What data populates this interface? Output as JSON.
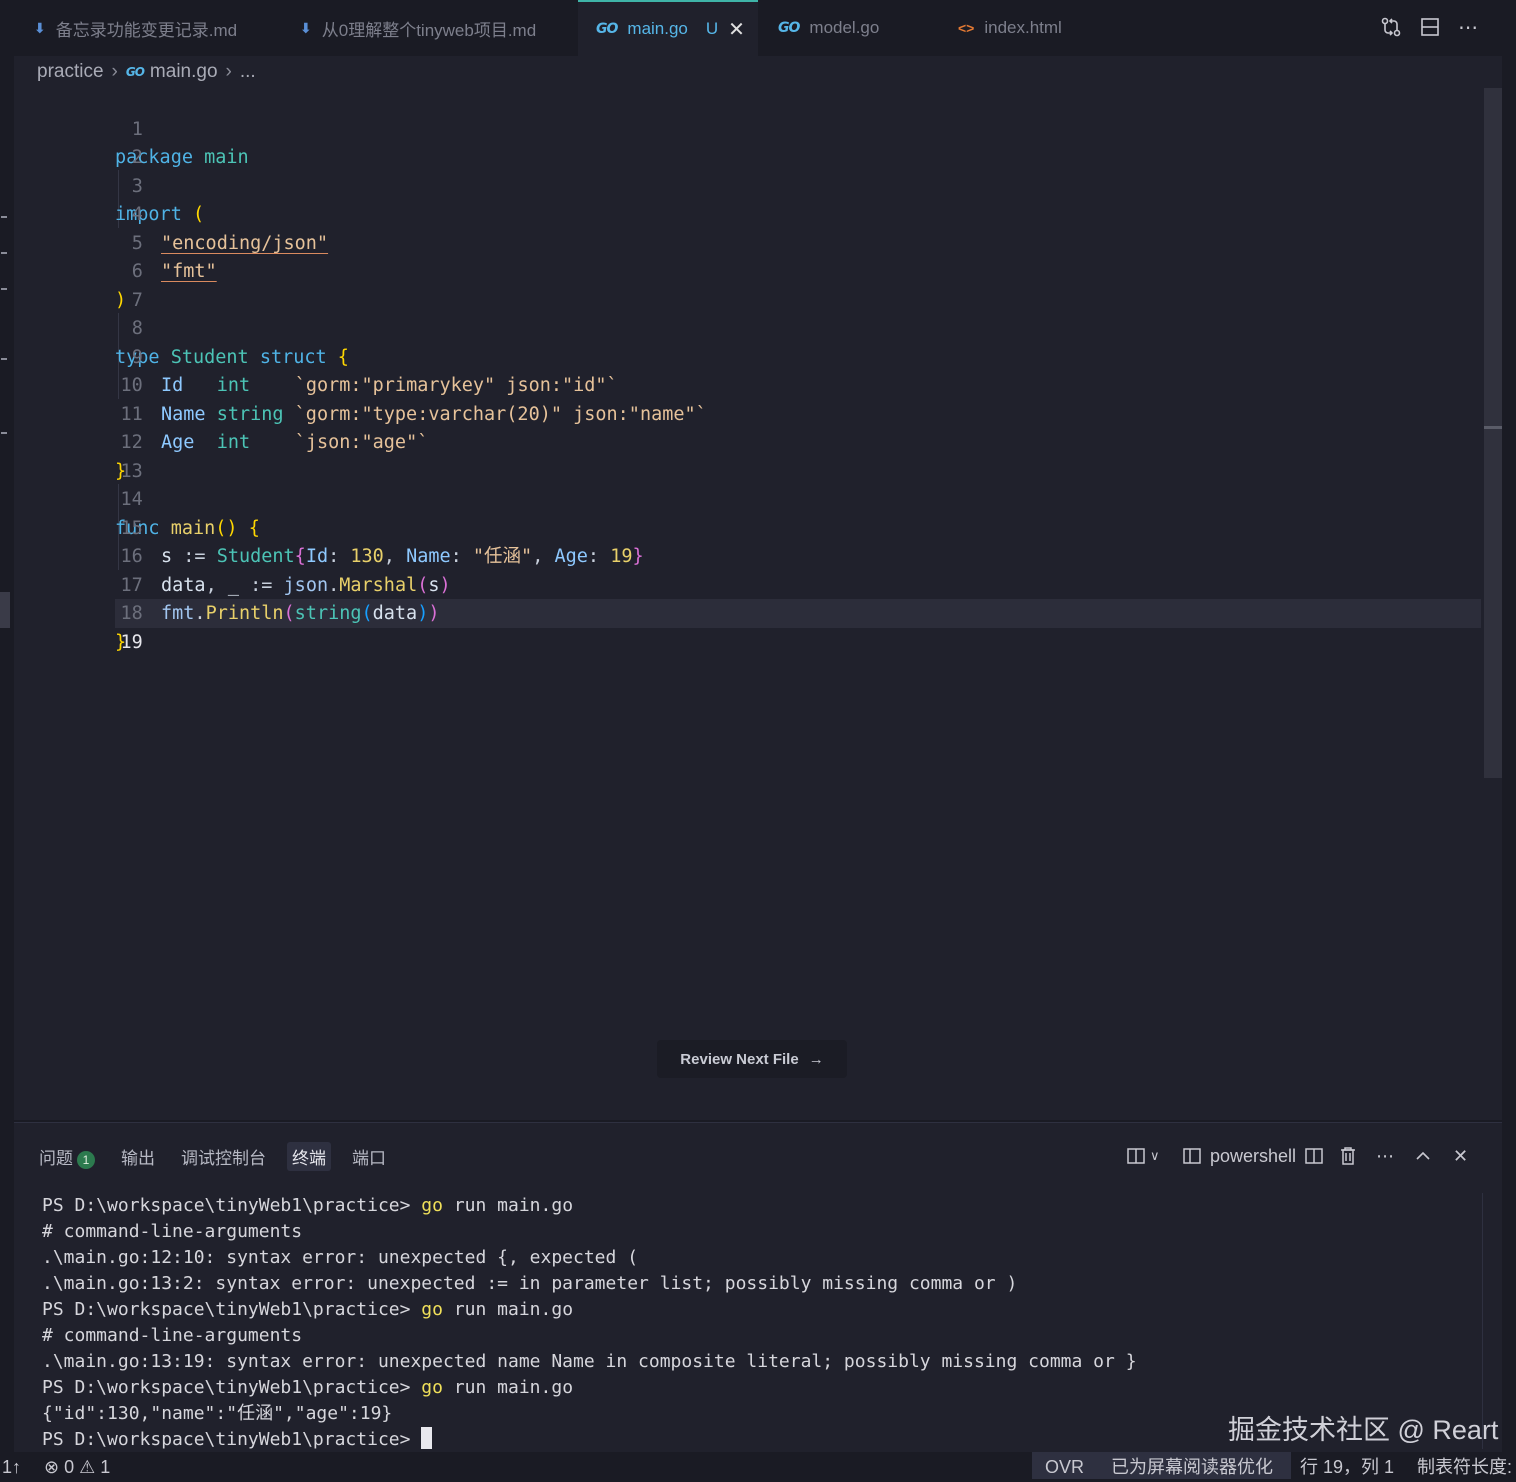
{
  "tabs": [
    {
      "label": "备忘录功能变更记录.md",
      "icon": "markdown-icon",
      "active": false
    },
    {
      "label": "从0理解整个tinyweb项目.md",
      "icon": "markdown-icon",
      "active": false
    },
    {
      "label": "main.go",
      "icon": "go-icon",
      "active": true,
      "modified": "U"
    },
    {
      "label": "model.go",
      "icon": "go-icon",
      "active": false
    },
    {
      "label": "index.html",
      "icon": "html-icon",
      "active": false
    }
  ],
  "icons": {
    "go": "GO",
    "html": "<>",
    "close": "✕",
    "more": "⋯"
  },
  "breadcrumb": {
    "folder": "practice",
    "file": "main.go",
    "more": "..."
  },
  "editor": {
    "line_numbers": [
      "1",
      "2",
      "3",
      "4",
      "5",
      "6",
      "7",
      "8",
      "9",
      "10",
      "11",
      "12",
      "13",
      "14",
      "15",
      "16",
      "17",
      "18",
      "19"
    ],
    "current_line": "19",
    "code": {
      "l1": [
        "package",
        "main"
      ],
      "l3": [
        "import",
        "("
      ],
      "l4": "\"encoding/json\"",
      "l5": "\"fmt\"",
      "l6": ")",
      "l8": [
        "type",
        "Student",
        "struct",
        "{"
      ],
      "l9": [
        "Id",
        "int",
        "`gorm:\"primarykey\" json:\"id\"`"
      ],
      "l10": [
        "Name",
        "string",
        "`gorm:\"type:varchar(20)\" json:\"name\"`"
      ],
      "l11": [
        "Age",
        "int",
        "`json:\"age\"`"
      ],
      "l12": "}",
      "l14": [
        "func",
        "main",
        "()",
        "{"
      ],
      "l15": [
        "s",
        ":=",
        "Student",
        "{",
        "Id",
        ":",
        "130",
        ",",
        "Name",
        ":",
        "\"任涵\"",
        ",",
        "Age",
        ":",
        "19",
        "}"
      ],
      "l16": [
        "data",
        ", ",
        "_",
        " := ",
        "json",
        ".",
        "Marshal",
        "(",
        "s",
        ")"
      ],
      "l17": [
        "fmt",
        ".",
        "Println",
        "(",
        "string",
        "(",
        "data",
        ")",
        ")"
      ],
      "l18": "}"
    },
    "review_button": "Review Next File",
    "review_arrow": "→"
  },
  "panel": {
    "tabs": [
      {
        "label": "问题",
        "badge": "1"
      },
      {
        "label": "输出"
      },
      {
        "label": "调试控制台"
      },
      {
        "label": "终端",
        "active": true
      },
      {
        "label": "端口"
      }
    ],
    "shell": "powershell",
    "terminal_lines": [
      {
        "prompt": "PS D:\\workspace\\tinyWeb1\\practice> ",
        "cmd": "go",
        "rest": " run main.go"
      },
      {
        "text": "# command-line-arguments"
      },
      {
        "text": ".\\main.go:12:10: syntax error: unexpected {, expected ("
      },
      {
        "text": ".\\main.go:13:2: syntax error: unexpected := in parameter list; possibly missing comma or )"
      },
      {
        "prompt": "PS D:\\workspace\\tinyWeb1\\practice> ",
        "cmd": "go",
        "rest": " run main.go"
      },
      {
        "text": "# command-line-arguments"
      },
      {
        "text": ".\\main.go:13:19: syntax error: unexpected name Name in composite literal; possibly missing comma or }"
      },
      {
        "prompt": "PS D:\\workspace\\tinyWeb1\\practice> ",
        "cmd": "go",
        "rest": " run main.go"
      },
      {
        "text": "{\"id\":130,\"name\":\"任涵\",\"age\":19}"
      },
      {
        "prompt": "PS D:\\workspace\\tinyWeb1\\practice> ",
        "cursor": true
      }
    ]
  },
  "watermark": "掘金技术社区 @ Reart",
  "status": {
    "sync": "1↑",
    "errors": "0",
    "warnings": "1",
    "mode": "OVR",
    "screen_reader": "已为屏幕阅读器优化",
    "position": "行 19，列 1",
    "tab_size": "制表符长度:"
  }
}
